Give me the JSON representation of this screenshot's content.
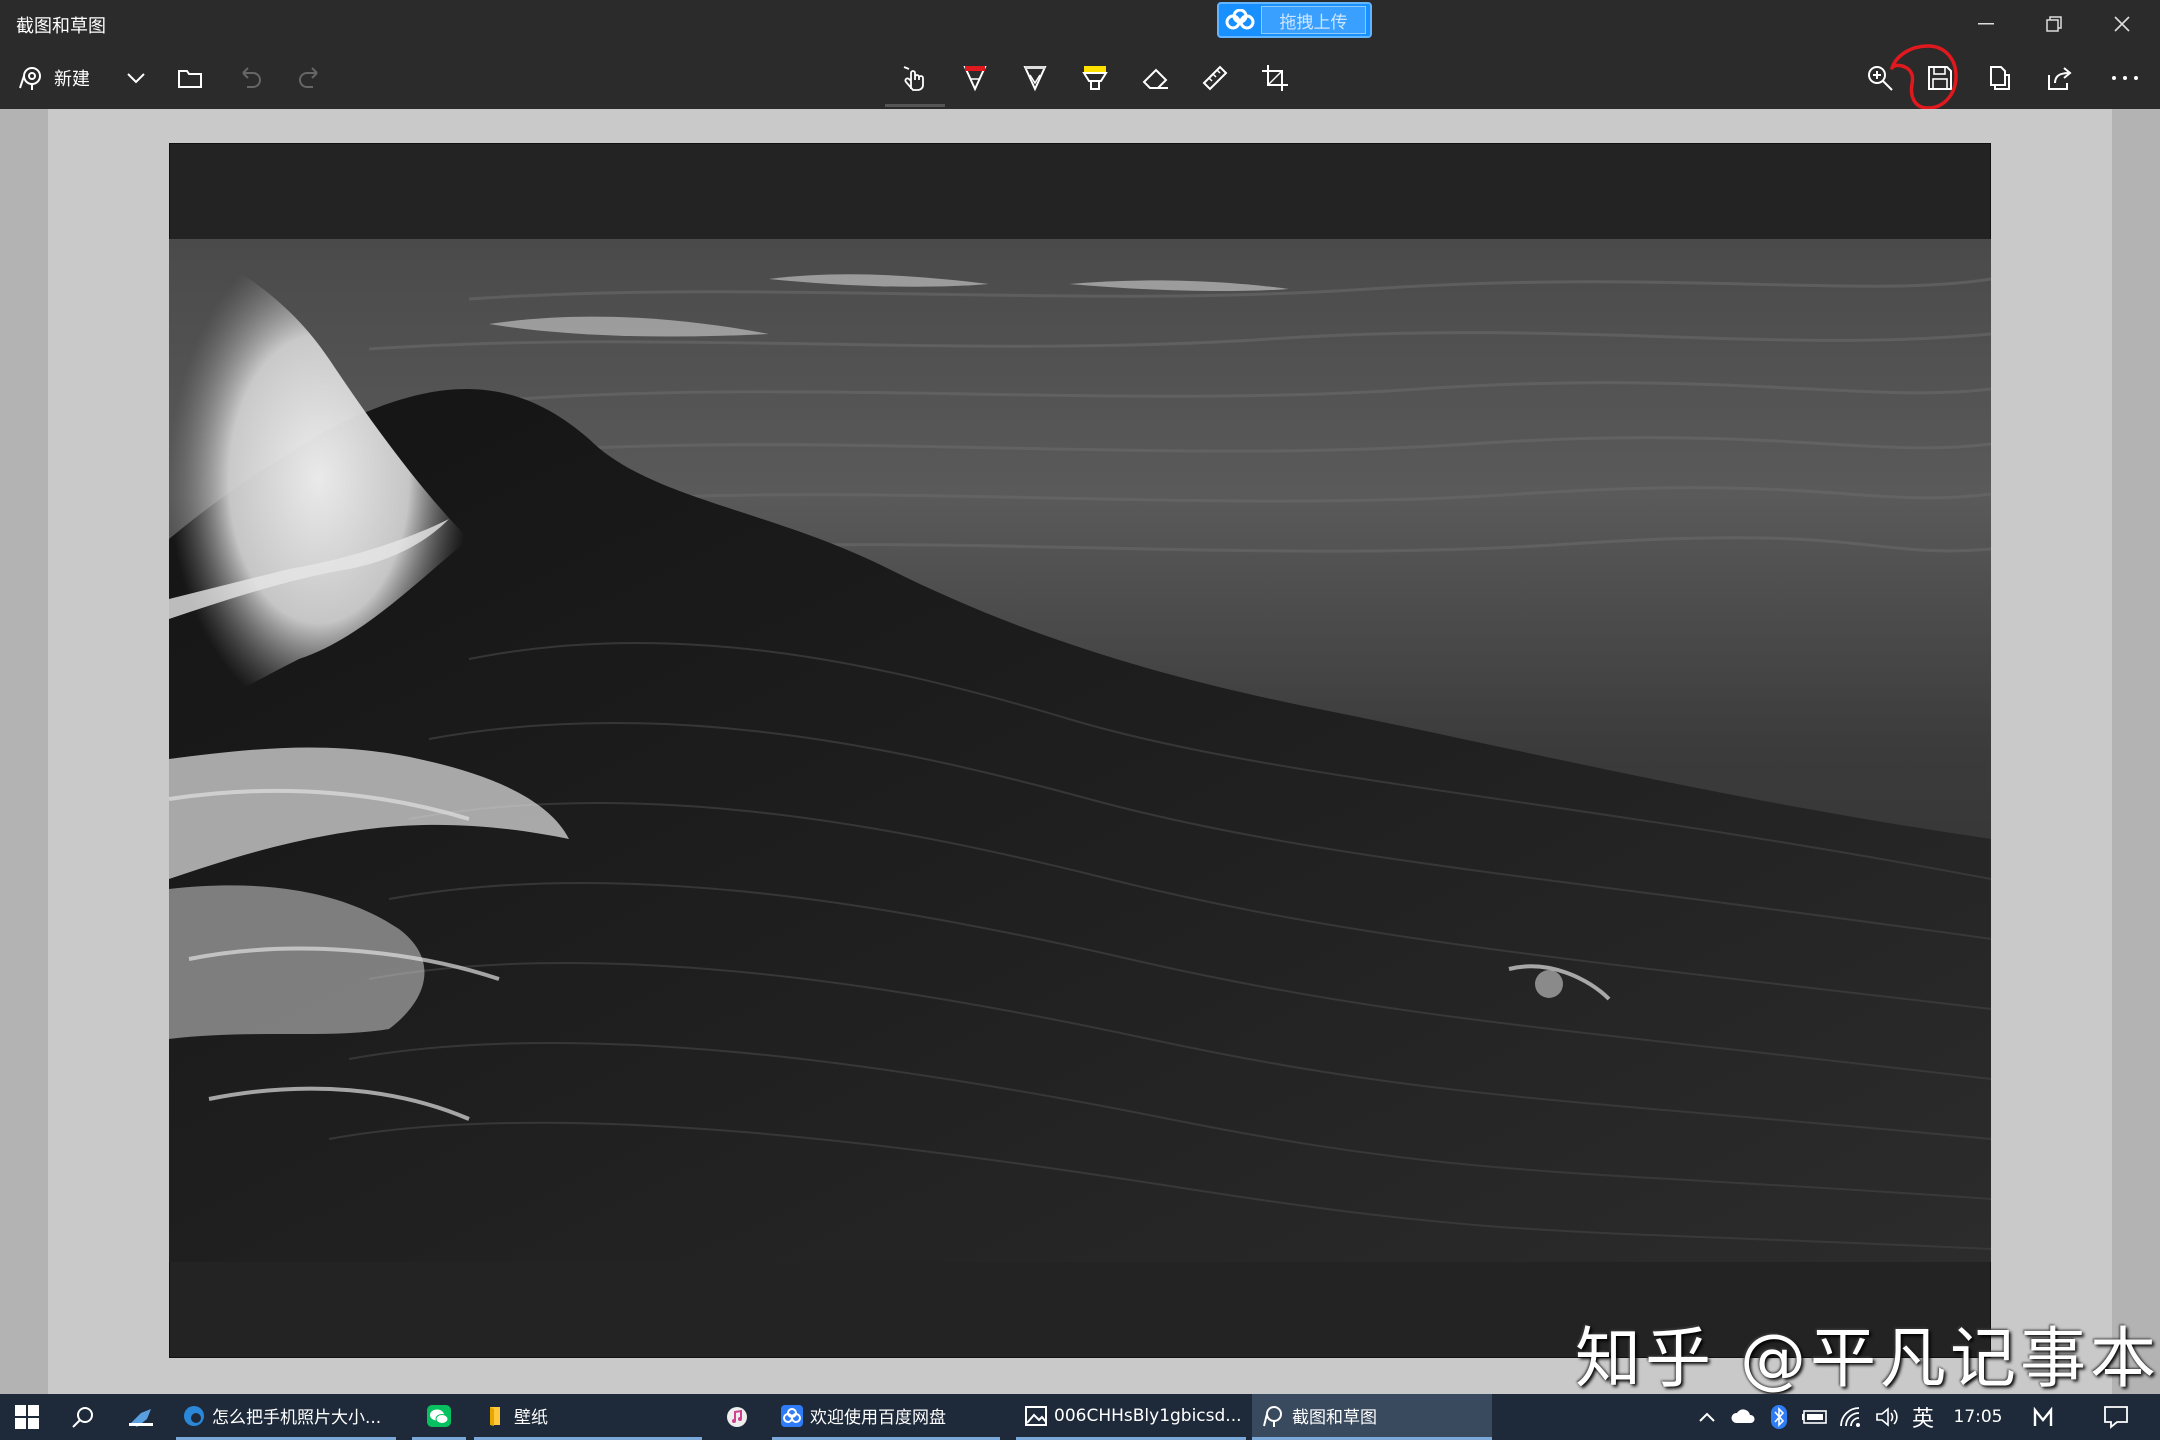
{
  "window": {
    "title": "截图和草图"
  },
  "uploader": {
    "label": "拖拽上传"
  },
  "toolbar": {
    "new_label": "新建",
    "tools": [
      "touch-writing",
      "ballpoint-pen",
      "pencil",
      "highlighter",
      "eraser",
      "ruler",
      "crop"
    ],
    "right": [
      "zoom",
      "save",
      "copy",
      "share",
      "more"
    ]
  },
  "watermark": {
    "text": "知乎 @平凡记事本"
  },
  "taskbar": {
    "items": [
      {
        "label": "怎么把手机照片大小..."
      },
      {
        "label": "壁纸"
      },
      {
        "label": "欢迎使用百度网盘"
      },
      {
        "label": "006CHHsBly1gbicsd..."
      },
      {
        "label": "截图和草图"
      }
    ],
    "ime": "英",
    "time": "17:05"
  },
  "colors": {
    "chrome": "#2b2b2b",
    "annotation": "#e0191e",
    "taskbar": "#1e2a3a",
    "uploader": "#1890ff"
  }
}
